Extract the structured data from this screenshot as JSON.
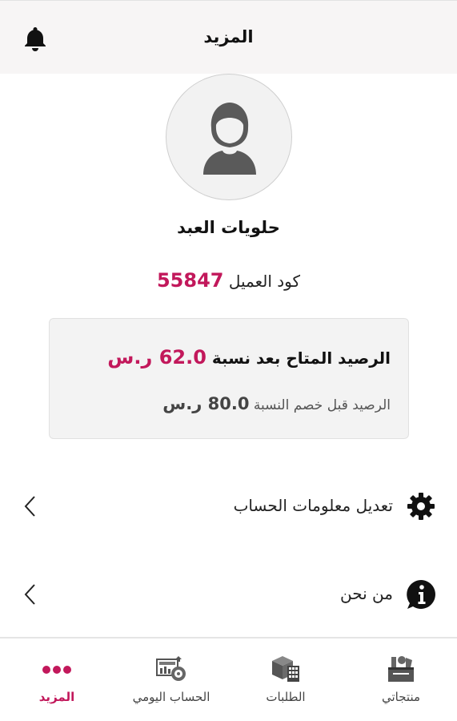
{
  "header": {
    "title": "المزيد",
    "bell_icon": "bell-icon"
  },
  "profile": {
    "avatar_icon": "user-avatar-icon",
    "name": "حلويات العبد",
    "code_label": "كود العميل",
    "code_value": "55847"
  },
  "balance": {
    "available_label": "الرصيد المتاح بعد نسبة",
    "available_value": "62.0",
    "currency": "ر.س",
    "before_label": "الرصيد قبل خصم النسبة",
    "before_value": "80.0"
  },
  "menu": [
    {
      "label": "تعديل معلومات الحساب",
      "icon": "gear-icon"
    },
    {
      "label": "من نحن",
      "icon": "info-icon"
    }
  ],
  "bottom_nav": [
    {
      "label": "منتجاتي",
      "icon": "products-icon"
    },
    {
      "label": "الطلبات",
      "icon": "orders-icon"
    },
    {
      "label": "الحساب اليومي",
      "icon": "daily-account-icon"
    },
    {
      "label": "المزيد",
      "icon": "more-dots-icon",
      "active": true
    }
  ],
  "colors": {
    "accent": "#c2185b",
    "header_bg": "#f7f5f5",
    "card_bg": "#f3f3f3"
  }
}
